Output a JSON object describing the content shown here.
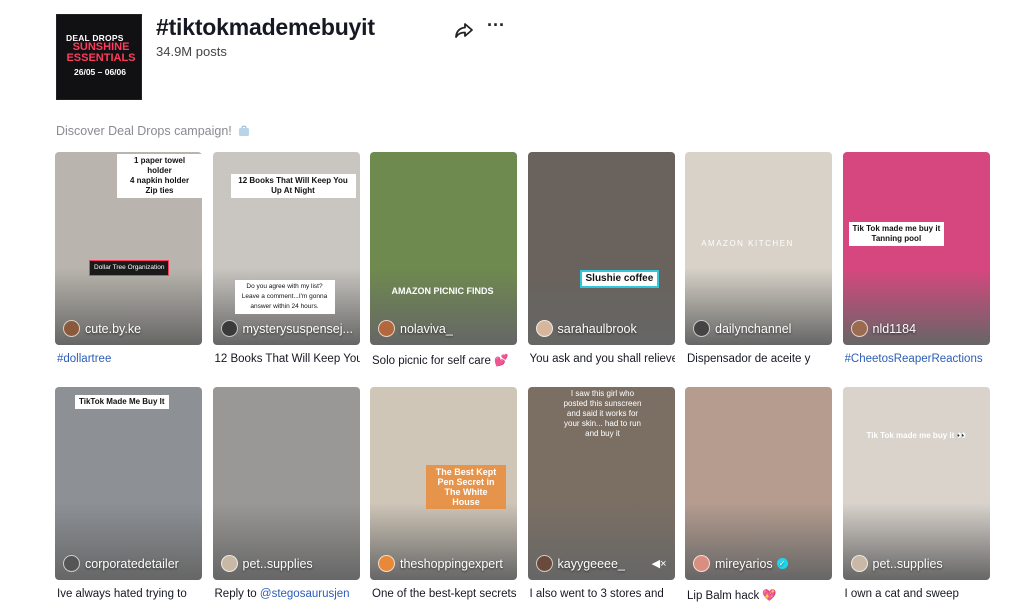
{
  "header": {
    "title": "#tiktokmademebuyit",
    "posts": "34.9M posts",
    "cover": {
      "line1": "DEAL DROPS",
      "line2": "SUNSHINE ESSENTIALS",
      "line3": "26/05 – 06/06"
    },
    "share_icon": "share-icon",
    "more_icon": "more-icon",
    "more_glyph": "···"
  },
  "discover": {
    "text": "Discover Deal Drops campaign!",
    "icon": "bag-icon"
  },
  "videos": [
    {
      "username": "cute.by.ke",
      "caption": "#dollartree",
      "overlay": "1 paper towel holder\n4 napkin holder\nZip ties",
      "overlay2": "Dollar Tree Organization",
      "bg": "#b9b5ae"
    },
    {
      "username": "mysterysuspensej...",
      "caption": "12 Books That Will Keep You",
      "overlay": "12 Books That Will Keep You Up At Night",
      "overlay2": "Do you agree with my list? Leave a comment...I'm gonna answer within 24 hours.",
      "bg": "#c9c6c1"
    },
    {
      "username": "nolaviva_",
      "caption": "Solo picnic for self care 💕",
      "overlay": "AMAZON PICNIC FINDS",
      "bg": "#6f8a4f"
    },
    {
      "username": "sarahaulbrook",
      "caption": "You ask and you shall relieve.",
      "overlay": "Slushie coffee",
      "bg": "#6a625c"
    },
    {
      "username": "dailynchannel",
      "caption": "Dispensador de aceite y",
      "overlay": "AMAZON KITCHEN",
      "bg": "#d8d2c8"
    },
    {
      "username": "nld1184",
      "caption": "#CheetosReaperReactions",
      "overlay": "Tik Tok made me buy it\nTanning pool",
      "bg": "#d7477f"
    },
    {
      "username": "corporatedetailer",
      "caption": "Ive always hated trying to",
      "overlay": "TikTok Made Me Buy It",
      "bg": "#8d9196"
    },
    {
      "username": "pet..supplies",
      "caption_prefix": "Reply to ",
      "caption_mention": "@stegosaurusjen",
      "bg": "#9a9896"
    },
    {
      "username": "theshoppingexpert",
      "caption": "One of the best-kept secrets",
      "overlay": "The Best Kept Pen Secret in The White House",
      "bg": "#cfc6b8"
    },
    {
      "username": "kayygeeee_",
      "caption": "I also went to 3 stores and",
      "overlay": "I saw this girl who posted this sunscreen and said it works for your skin... had to run and buy it",
      "bg": "#7b6f64"
    },
    {
      "username": "mireyarios",
      "caption": "Lip Balm hack 💖",
      "verified": true,
      "bg": "#b59c8f"
    },
    {
      "username": "pet..supplies",
      "caption": "I own a cat and sweep",
      "overlay": "Tik Tok made me buy it 👀",
      "bg": "#d9d3cc"
    }
  ],
  "colors": {
    "accent": "#fe2c55",
    "hashtag": "#2b5db9",
    "verified": "#20d5ec"
  }
}
